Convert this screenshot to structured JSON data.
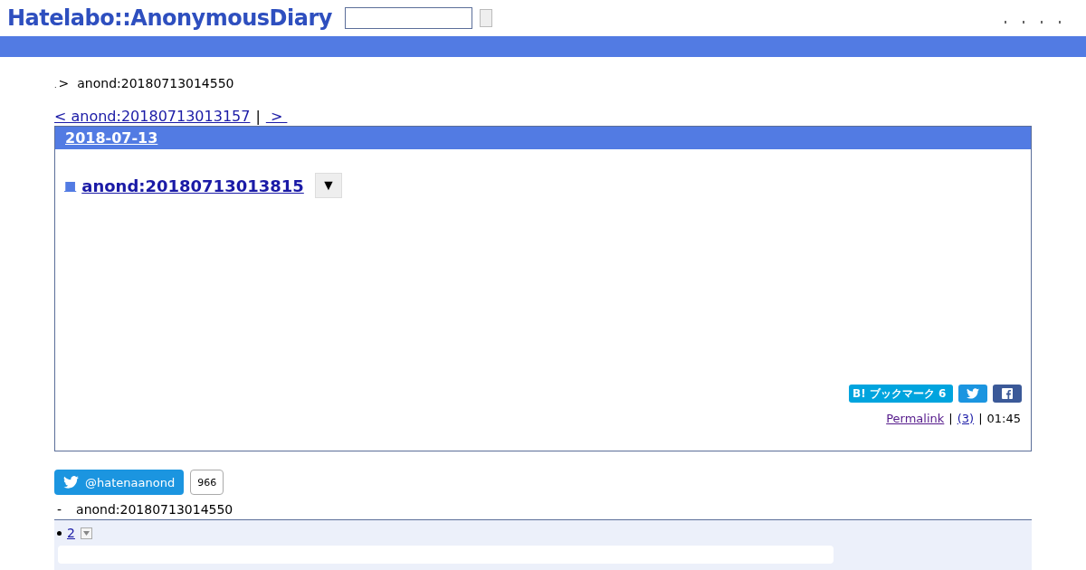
{
  "header": {
    "logo": "Hatelabo::AnonymousDiary"
  },
  "breadcrumb": {
    "lead": ".",
    "separator": ">",
    "current": "anond:20180713014550"
  },
  "pager": {
    "prev": "< anond:20180713013157",
    "divider": "|",
    "next": " > "
  },
  "day": {
    "date": "2018-07-13",
    "entry": {
      "mark": "■",
      "title": "anond:20180713013815",
      "menu": "▼",
      "share": {
        "bookmark": "B! ブックマーク 6"
      },
      "footer": {
        "permalink": "Permalink",
        "sep1": "|",
        "comments": "(3)",
        "sep2": "|",
        "time": "01:45"
      }
    }
  },
  "follow": {
    "handle": "@hatenaanond",
    "count": "966"
  },
  "refs": {
    "dash": "-",
    "title": "anond:20180713014550",
    "items": [
      {
        "label": "2"
      }
    ]
  }
}
